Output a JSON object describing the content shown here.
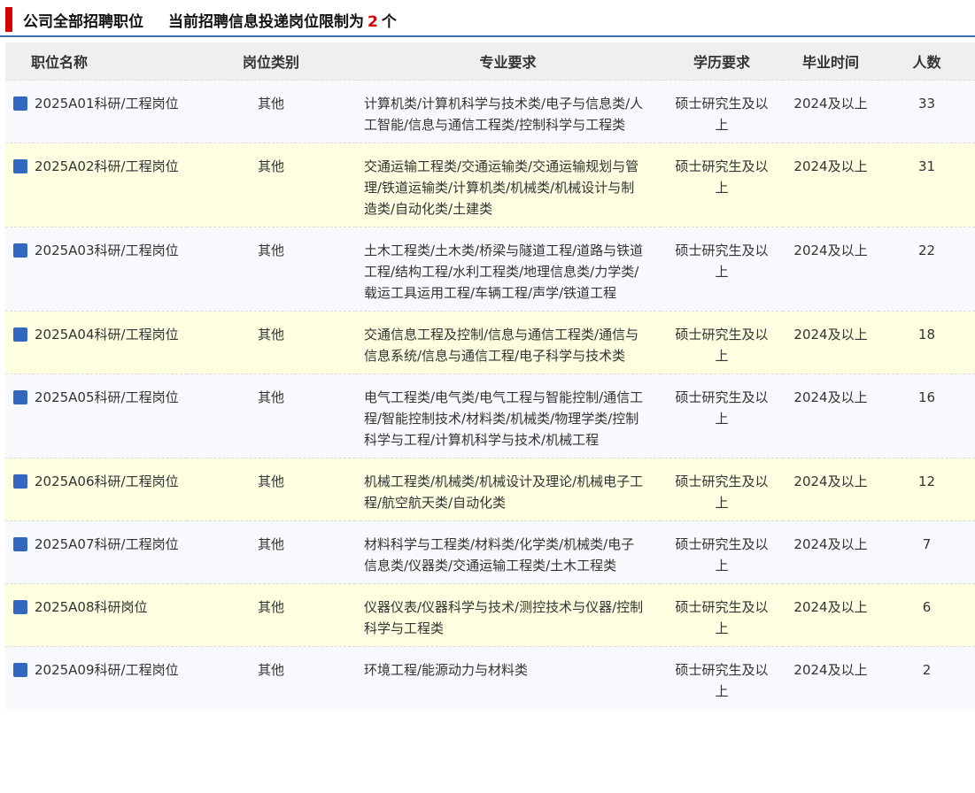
{
  "header": {
    "title": "公司全部招聘职位",
    "limit_prefix": "当前招聘信息投递岗位限制为",
    "limit_num": "2",
    "limit_suffix": "个"
  },
  "table": {
    "columns": [
      "职位名称",
      "岗位类别",
      "专业要求",
      "学历要求",
      "毕业时间",
      "人数"
    ],
    "rows": [
      {
        "name": "2025A01科研/工程岗位",
        "category": "其他",
        "major": "计算机类/计算机科学与技术类/电子与信息类/人工智能/信息与通信工程类/控制科学与工程类",
        "education": "硕士研究生及以上",
        "grad": "2024及以上",
        "count": "33"
      },
      {
        "name": "2025A02科研/工程岗位",
        "category": "其他",
        "major": "交通运输工程类/交通运输类/交通运输规划与管理/铁道运输类/计算机类/机械类/机械设计与制造类/自动化类/土建类",
        "education": "硕士研究生及以上",
        "grad": "2024及以上",
        "count": "31"
      },
      {
        "name": "2025A03科研/工程岗位",
        "category": "其他",
        "major": "土木工程类/土木类/桥梁与隧道工程/道路与铁道工程/结构工程/水利工程类/地理信息类/力学类/载运工具运用工程/车辆工程/声学/铁道工程",
        "education": "硕士研究生及以上",
        "grad": "2024及以上",
        "count": "22"
      },
      {
        "name": "2025A04科研/工程岗位",
        "category": "其他",
        "major": "交通信息工程及控制/信息与通信工程类/通信与信息系统/信息与通信工程/电子科学与技术类",
        "education": "硕士研究生及以上",
        "grad": "2024及以上",
        "count": "18"
      },
      {
        "name": "2025A05科研/工程岗位",
        "category": "其他",
        "major": "电气工程类/电气类/电气工程与智能控制/通信工程/智能控制技术/材料类/机械类/物理学类/控制科学与工程/计算机科学与技术/机械工程",
        "education": "硕士研究生及以上",
        "grad": "2024及以上",
        "count": "16"
      },
      {
        "name": "2025A06科研/工程岗位",
        "category": "其他",
        "major": "机械工程类/机械类/机械设计及理论/机械电子工程/航空航天类/自动化类",
        "education": "硕士研究生及以上",
        "grad": "2024及以上",
        "count": "12"
      },
      {
        "name": "2025A07科研/工程岗位",
        "category": "其他",
        "major": "材料科学与工程类/材料类/化学类/机械类/电子信息类/仪器类/交通运输工程类/土木工程类",
        "education": "硕士研究生及以上",
        "grad": "2024及以上",
        "count": "7"
      },
      {
        "name": "2025A08科研岗位",
        "category": "其他",
        "major": "仪器仪表/仪器科学与技术/测控技术与仪器/控制科学与工程类",
        "education": "硕士研究生及以上",
        "grad": "2024及以上",
        "count": "6"
      },
      {
        "name": "2025A09科研/工程岗位",
        "category": "其他",
        "major": "环境工程/能源动力与材料类",
        "education": "硕士研究生及以上",
        "grad": "2024及以上",
        "count": "2"
      }
    ]
  },
  "colors": {
    "accent_red": "#d50000",
    "accent_blue": "#3d6fb5",
    "row_odd": "#f7f9fd",
    "row_even": "#fefee0",
    "icon_blue": "#3468c0"
  }
}
